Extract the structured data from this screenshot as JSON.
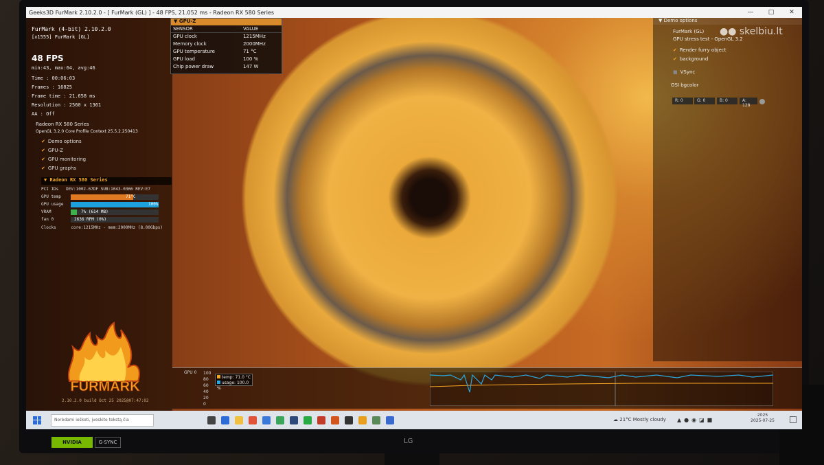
{
  "window": {
    "title": "Geeks3D FurMark 2.10.2.0 - [ FurMark (GL) ] - 48 FPS, 21.052 ms - Radeon RX 580 Series"
  },
  "left": {
    "title": "FurMark (4-bit) 2.10.2.0",
    "subtitle": "[x1555] FurMark [GL]",
    "fps": "48 FPS",
    "minmax": "min:43, max:64, avg:46",
    "stats": [
      "Time       : 00:06:03",
      "Frames     : 16825",
      "Frame time : 21.658 ms",
      "Resolution : 2560 x 1361",
      "AA         : Off"
    ],
    "gpu_name": "Radeon RX 580 Series",
    "opengl": "OpenGL 3.2.0 Core Profile Context 25.5.2.250413",
    "options": [
      "Demo options",
      "GPU-Z",
      "GPU monitoring",
      "GPU graphs"
    ],
    "monitor_header": "Radeon RX 580 Series",
    "monitor": [
      {
        "label": "PCI IDs",
        "value": "DEV:1002-67DF SUB:1043-0366 REV:E7"
      },
      {
        "label": "GPU temp",
        "value": "71°C"
      },
      {
        "label": "GPU usage",
        "value": "100%"
      },
      {
        "label": "VRAM",
        "value": "7% (614 MB)"
      },
      {
        "label": "fan 0",
        "value": "2636 RPM (0%)"
      },
      {
        "label": "Clocks",
        "value": "core:1215MHz - mem:2000MHz (8.00Gbps)"
      }
    ],
    "bars": {
      "temp": 0.71,
      "usage": 1.0,
      "vram": 0.07,
      "fan": 0.0
    }
  },
  "gpuz": {
    "title": "GPU-Z",
    "col_sensor": "SENSOR",
    "col_value": "VALUE",
    "rows": [
      {
        "sensor": "GPU clock",
        "value": "1215MHz"
      },
      {
        "sensor": "Memory clock",
        "value": "2000MHz"
      },
      {
        "sensor": "GPU temperature",
        "value": "71 °C"
      },
      {
        "sensor": "GPU load",
        "value": "100 %"
      },
      {
        "sensor": "Chip power draw",
        "value": "147 W"
      }
    ]
  },
  "right": {
    "header": "Demo options",
    "line1": "FurMark (GL)",
    "line2": "GPU stress test - OpenGL 3.2",
    "opt1": "Render furry object",
    "opt2": "background",
    "vsync": "VSync",
    "osi": "OSI bgcolor",
    "channels": [
      "R: 0",
      "G: 0",
      "B: 0",
      "A: 128"
    ]
  },
  "watermark": "skelbiu.lt",
  "logo_text": "FURMARK",
  "version": "2.10.2.0 build Oct 25 2025@07:47:02",
  "graph": {
    "label": "GPU 0",
    "ticks": [
      "100",
      "80",
      "60",
      "40",
      "20",
      "0"
    ],
    "legend_temp": "temp: 71.0 °C",
    "legend_usage": "usage: 100.0 %",
    "colors": {
      "temp": "#f5a623",
      "usage": "#2aa8e0"
    }
  },
  "taskbar": {
    "search": "Norėdami ieškoti, įveskite tekstą čia",
    "weather": "21°C Mostly cloudy",
    "time": "2025",
    "date": "2025-07-25"
  },
  "monitor_brand": {
    "nvidia": "NVIDIA",
    "gsync": "G-SYNC",
    "lg": "LG"
  }
}
